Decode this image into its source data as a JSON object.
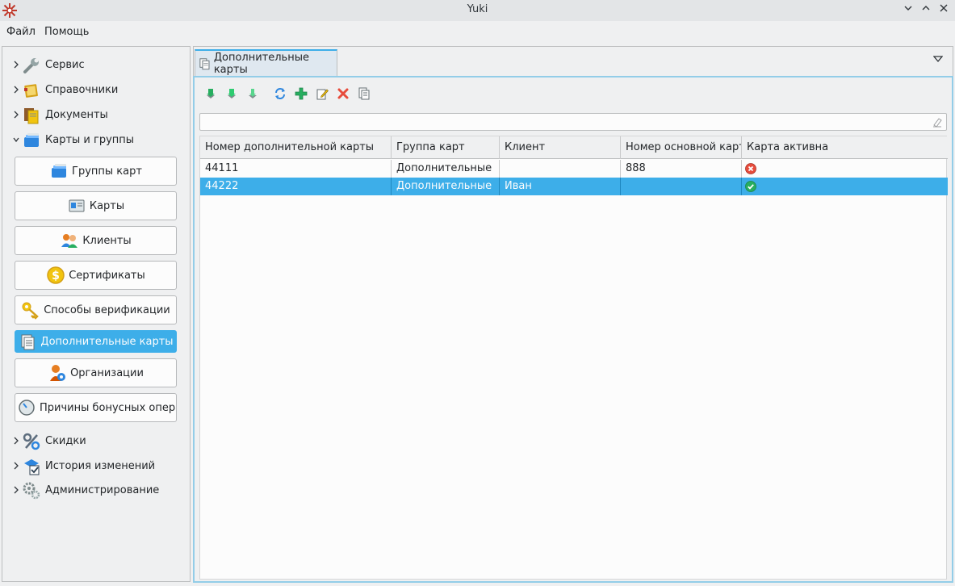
{
  "window": {
    "title": "Yuki"
  },
  "menu": {
    "items": [
      "Файл",
      "Помощь"
    ]
  },
  "sidebar": {
    "top_items": [
      "Сервис",
      "Справочники",
      "Документы",
      "Карты и группы"
    ],
    "buttons": [
      "Группы карт",
      "Карты",
      "Клиенты",
      "Сертификаты",
      "Способы верификации",
      "Дополнительные карты",
      "Организации",
      "Причины бонусных операций"
    ],
    "bottom_items": [
      "Скидки",
      "История изменений",
      "Администрирование"
    ]
  },
  "tab": {
    "label": "Дополнительные карты"
  },
  "toolbar": {
    "icons": [
      "export-icon",
      "export-all-icon",
      "import-icon",
      "refresh-icon",
      "add-icon",
      "edit-icon",
      "delete-icon",
      "copy-icon"
    ]
  },
  "filter": {
    "value": "",
    "placeholder": ""
  },
  "table": {
    "columns": [
      "Номер дополнительной карты",
      "Группа карт",
      "Клиент",
      "Номер основной карт",
      "Карта активна"
    ],
    "rows": [
      {
        "number": "44111",
        "group": "Дополнительные",
        "client": "",
        "main_number": "888",
        "active": "inactive",
        "selected": false
      },
      {
        "number": "44222",
        "group": "Дополнительные",
        "client": "Иван",
        "main_number": "",
        "active": "active",
        "selected": true
      }
    ]
  },
  "colors": {
    "accent": "#3daee9",
    "error": "#da4453",
    "success": "#27ae60"
  }
}
